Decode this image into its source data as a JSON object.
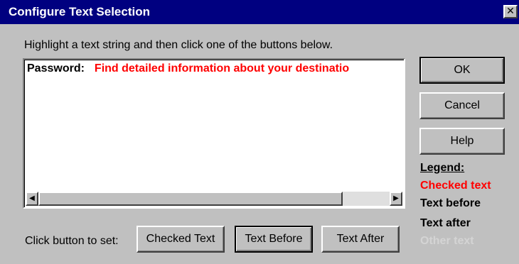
{
  "window": {
    "title": "Configure Text Selection",
    "close_glyph": "✕"
  },
  "instruction": "Highlight a text string and then click one of the buttons below.",
  "textbox": {
    "label": "Password:",
    "checked_text": "Find detailed information about your destinatio"
  },
  "scrollbar": {
    "left_arrow": "◀",
    "right_arrow": "▶"
  },
  "buttons": {
    "ok": "OK",
    "cancel": "Cancel",
    "help": "Help"
  },
  "legend": {
    "title": "Legend:",
    "checked": "Checked text",
    "before": "Text before",
    "after": "Text after",
    "other": "Other text"
  },
  "legend_colors": {
    "checked": "#ff0000",
    "before": "#000000",
    "after": "#000000",
    "other": "#d4d4d4"
  },
  "set_bar": {
    "label": "Click button to set:",
    "checked_text": "Checked Text",
    "text_before": "Text Before",
    "text_after": "Text After"
  }
}
